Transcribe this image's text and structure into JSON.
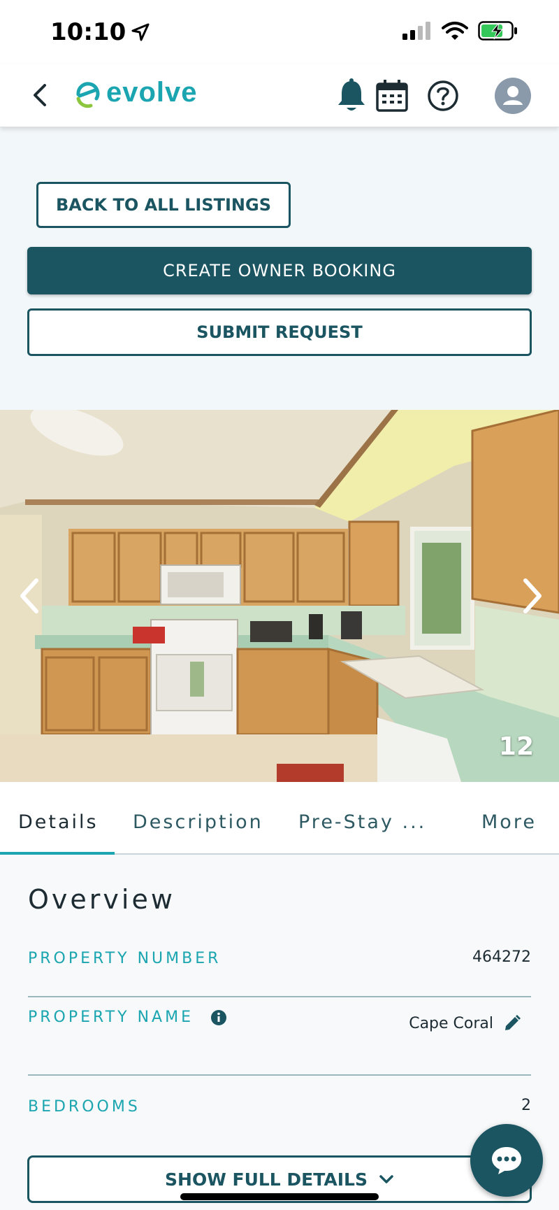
{
  "status_bar": {
    "time": "10:10"
  },
  "header": {
    "logo_text": "evolve",
    "icons": [
      "back-icon",
      "bell-icon",
      "calendar-icon",
      "help-icon",
      "avatar-icon"
    ]
  },
  "actions": {
    "back_to_listings": "BACK TO ALL LISTINGS",
    "create_owner_booking": "CREATE OWNER BOOKING",
    "submit_request": "SUBMIT REQUEST"
  },
  "gallery": {
    "photo_count": "12"
  },
  "tabs": [
    {
      "label": "Details",
      "active": true
    },
    {
      "label": "Description",
      "active": false
    },
    {
      "label": "Pre-Stay ...",
      "active": false
    },
    {
      "label": "More",
      "active": false
    }
  ],
  "overview": {
    "title": "Overview",
    "rows": [
      {
        "label": "PROPERTY NUMBER",
        "value": "464272"
      },
      {
        "label": "PROPERTY NAME",
        "value": "Cape Coral"
      },
      {
        "label": "BEDROOMS",
        "value": "2"
      }
    ],
    "show_full_details": "SHOW FULL DETAILS"
  },
  "colors": {
    "brand_dark": "#1a5561",
    "brand_teal": "#1ba5b0",
    "logo_green": "#8cc63f",
    "battery_green": "#34c759"
  }
}
